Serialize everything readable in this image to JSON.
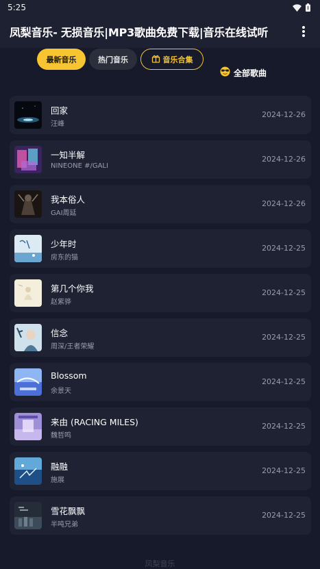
{
  "status_bar": {
    "time": "5:25",
    "icons": [
      "wifi-icon",
      "battery-icon"
    ]
  },
  "app_bar": {
    "title": "凤梨音乐- 无损音乐|MP3歌曲免费下载|音乐在线试听",
    "menu_icon": "more-vert-icon"
  },
  "tabs": [
    {
      "label": "最新音乐",
      "active": true
    },
    {
      "label": "热门音乐",
      "active": false
    },
    {
      "label": "音乐合集",
      "active": false,
      "icon": "gift-icon"
    }
  ],
  "all_songs": {
    "label": "全部歌曲",
    "icon": "sunglasses-emoji-icon"
  },
  "songs": [
    {
      "title": "回家",
      "artist": "汪峰",
      "date": "2024-12-26"
    },
    {
      "title": "一知半解",
      "artist": "NINEONE #/GALI",
      "date": "2024-12-26"
    },
    {
      "title": "我本俗人",
      "artist": "GAI周延",
      "date": "2024-12-26"
    },
    {
      "title": "少年时",
      "artist": "房东的猫",
      "date": "2024-12-25"
    },
    {
      "title": "第几个你我",
      "artist": "赵紫骅",
      "date": "2024-12-25"
    },
    {
      "title": "信念",
      "artist": "周深/王者荣耀",
      "date": "2024-12-25"
    },
    {
      "title": "Blossom",
      "artist": "余景天",
      "date": "2024-12-25"
    },
    {
      "title": "来由 (RACING MILES)",
      "artist": "魏哲鸣",
      "date": "2024-12-25"
    },
    {
      "title": "融融",
      "artist": "施展",
      "date": "2024-12-25"
    },
    {
      "title": "雪花飘飘",
      "artist": "半吨兄弟",
      "date": "2024-12-25"
    }
  ],
  "footer": {
    "text": "凤梨音乐"
  },
  "colors": {
    "background": "#161a2a",
    "card": "#1e2233",
    "accent": "#f7c531"
  }
}
